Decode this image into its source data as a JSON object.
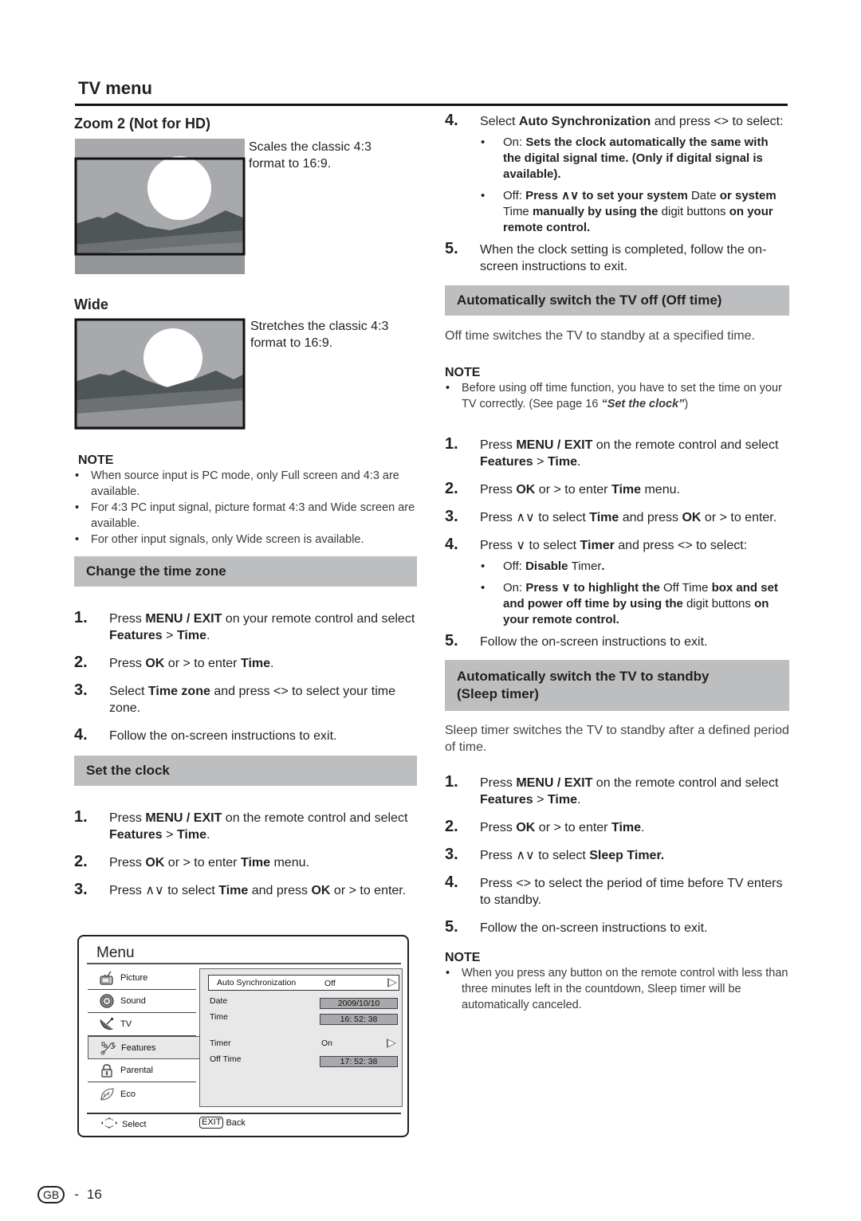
{
  "page": {
    "title": "TV menu",
    "footer": {
      "region_badge": "GB",
      "separator": "-",
      "page_number": "16"
    }
  },
  "left": {
    "zoom2": {
      "heading": "Zoom 2 (Not for HD)",
      "caption_line1": "Scales the classic 4:3",
      "caption_line2": "format to 16:9."
    },
    "wide": {
      "heading": "Wide",
      "caption_line1": "Stretches the classic 4:3",
      "caption_line2": "format to 16:9."
    },
    "note": {
      "title": "NOTE",
      "items": [
        "When source input is PC mode, only Full screen and 4:3 are available.",
        "For 4:3 PC input signal, picture format 4:3 and Wide screen are available.",
        "For other input signals, only Wide screen is available."
      ]
    },
    "time_zone": {
      "heading": "Change the time zone",
      "steps": [
        {
          "num": "1.",
          "parts": [
            "Press ",
            "MENU / EXIT",
            " on your remote control and select ",
            "Features",
            " > ",
            "Time",
            "."
          ]
        },
        {
          "num": "2.",
          "parts": [
            "Press ",
            "OK",
            " or > to enter ",
            "Time",
            "."
          ]
        },
        {
          "num": "3.",
          "parts": [
            "Select ",
            "Time zone",
            " and press <> to select your time zone."
          ]
        },
        {
          "num": "4.",
          "parts": [
            "Follow the on-screen instructions to exit."
          ]
        }
      ]
    },
    "set_clock": {
      "heading": "Set the clock",
      "steps": [
        {
          "num": "1.",
          "parts": [
            "Press ",
            "MENU / EXIT",
            " on the remote control and select ",
            "Features",
            " > ",
            "Time",
            "."
          ]
        },
        {
          "num": "2.",
          "parts": [
            "Press ",
            "OK",
            " or > to enter ",
            "Time",
            " menu."
          ]
        },
        {
          "num": "3.",
          "parts": [
            "Press ∧∨ to select ",
            "Time",
            " and press ",
            "OK",
            " or > to enter."
          ]
        }
      ]
    },
    "menu_screenshot": {
      "title": "Menu",
      "sidebar": [
        {
          "label": "Picture",
          "icon": "tv-icon"
        },
        {
          "label": "Sound",
          "icon": "speaker-icon"
        },
        {
          "label": "TV",
          "icon": "satellite-dish-icon"
        },
        {
          "label": "Features",
          "icon": "tools-icon",
          "active": true
        },
        {
          "label": "Parental",
          "icon": "padlock-icon"
        },
        {
          "label": "Eco",
          "icon": "leaf-icon"
        }
      ],
      "panel": {
        "auto_sync": {
          "label": "Auto Synchronization",
          "value": "Off"
        },
        "date": {
          "label": "Date",
          "value": "2009/10/10"
        },
        "time": {
          "label": "Time",
          "value": "16: 52: 38"
        },
        "timer": {
          "label": "Timer",
          "value": "On"
        },
        "off_time": {
          "label": "Off Time",
          "value": "17: 52: 38"
        }
      },
      "footer": {
        "select_label": "Select",
        "exit_key": "EXIT",
        "back_label": "Back"
      }
    }
  },
  "right": {
    "clock_cont": {
      "steps": [
        {
          "num": "4.",
          "parts": [
            "Select ",
            "Auto Synchronization",
            " and press <> to select:"
          ]
        },
        {
          "num": "5.",
          "parts": [
            "When the clock setting is completed, follow the on-screen instructions to exit."
          ]
        }
      ],
      "bullets": [
        {
          "parts": [
            "On:",
            " Sets the clock automatically the same with the digital signal time. (Only if digital signal is available)."
          ]
        },
        {
          "parts": [
            "Off:",
            " Press ∧∨ to set your system ",
            "Date",
            " or system ",
            "Time",
            " manually by using the ",
            "digit buttons",
            " on your remote control."
          ]
        }
      ]
    },
    "off_time": {
      "heading": "Automatically switch the TV off (Off time)",
      "intro": "Off time switches the TV to standby at a specified time.",
      "note": {
        "title": "NOTE",
        "text": "Before using off time function, you have to set the time on your TV correctly. (See page 16 ",
        "link": "“Set the clock”",
        "suffix": ")"
      },
      "steps": [
        {
          "num": "1.",
          "parts": [
            "Press ",
            "MENU / EXIT",
            " on the remote control and select ",
            "Features",
            " > ",
            "Time",
            "."
          ]
        },
        {
          "num": "2.",
          "parts": [
            "Press ",
            "OK",
            " or > to enter ",
            "Time",
            " menu."
          ]
        },
        {
          "num": "3.",
          "parts": [
            "Press ∧∨ to select ",
            "Time",
            " and press ",
            "OK",
            " or > to enter."
          ]
        },
        {
          "num": "4.",
          "parts": [
            "Press ∨ to select ",
            "Timer",
            " and press <> to select:"
          ]
        },
        {
          "num": "5.",
          "parts": [
            "Follow the on-screen instructions to exit."
          ]
        }
      ],
      "bullets": [
        {
          "parts": [
            "Off:",
            " Disable ",
            "Timer",
            "."
          ]
        },
        {
          "parts": [
            "On:",
            " Press ∨ to highlight the ",
            "Off Time",
            " box and set and power off time by using the ",
            "digit buttons",
            " on your remote control."
          ]
        }
      ]
    },
    "sleep": {
      "heading_line1": "Automatically switch the TV to standby",
      "heading_line2": "(Sleep timer)",
      "intro": "Sleep timer switches the TV to standby after a defined period of time.",
      "steps": [
        {
          "num": "1.",
          "parts": [
            "Press ",
            "MENU / EXIT",
            " on the remote control and select ",
            "Features",
            " > ",
            "Time",
            "."
          ]
        },
        {
          "num": "2.",
          "parts": [
            "Press ",
            "OK",
            " or > to enter ",
            "Time",
            "."
          ]
        },
        {
          "num": "3.",
          "parts": [
            "Press ∧∨ to select ",
            "Sleep Timer.",
            ""
          ]
        },
        {
          "num": "4.",
          "parts": [
            "Press <> to select the period of time before TV enters to standby."
          ]
        },
        {
          "num": "5.",
          "parts": [
            "Follow the on-screen instructions to exit."
          ]
        }
      ],
      "note": {
        "title": "NOTE",
        "items": [
          "When you press any button on the remote control with less than three minutes left in the countdown, Sleep timer will be automatically canceled."
        ]
      }
    }
  }
}
